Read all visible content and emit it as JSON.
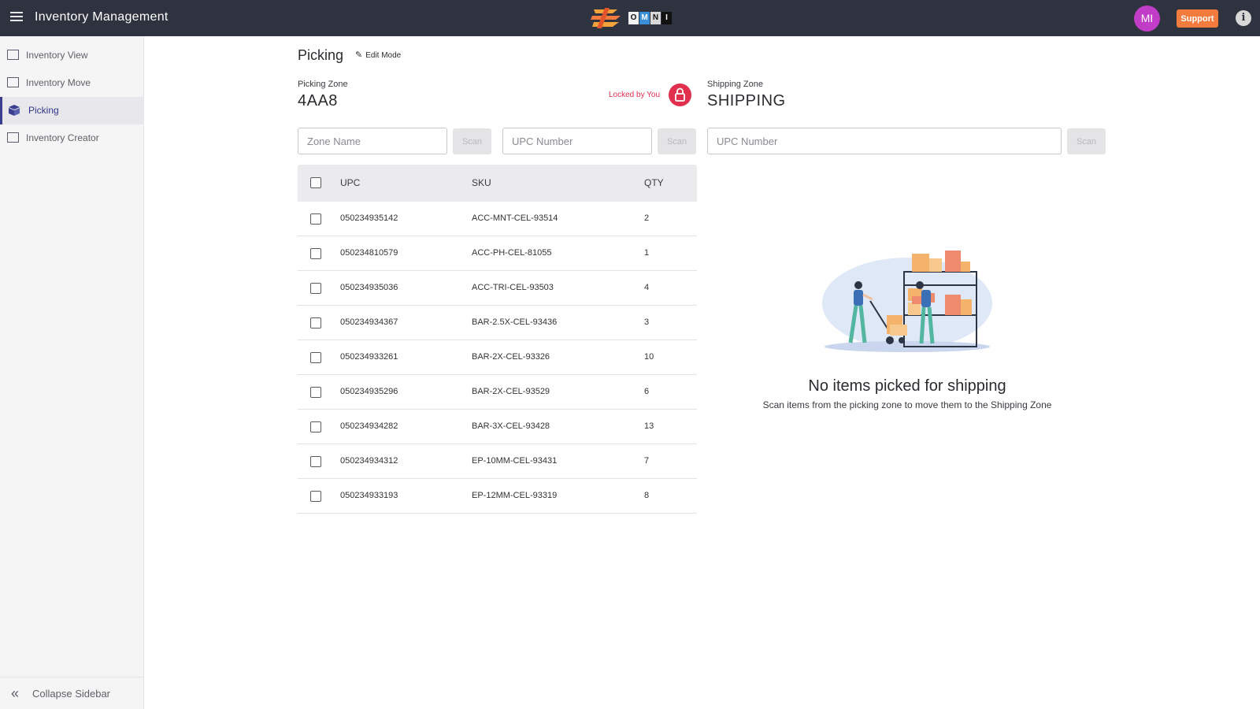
{
  "header": {
    "title": "Inventory Management",
    "brand_letters": [
      "O",
      "M",
      "N",
      "I"
    ],
    "brand_letter_colors": [
      "#f2f2f2",
      "#3a8fd9",
      "#d8d8d8",
      "#111111"
    ],
    "avatar_initials": "MI",
    "support_label": "Support",
    "info_glyph": "i"
  },
  "sidebar": {
    "items": [
      {
        "label": "Inventory View",
        "icon": "grid-icon",
        "active": false
      },
      {
        "label": "Inventory Move",
        "icon": "move-icon",
        "active": false
      },
      {
        "label": "Picking",
        "icon": "boxes-icon",
        "active": true
      },
      {
        "label": "Inventory Creator",
        "icon": "grid-icon",
        "active": false
      }
    ],
    "collapse_label": "Collapse Sidebar"
  },
  "main": {
    "title": "Picking",
    "edit_mode_label": "Edit Mode",
    "picking_zone_label": "Picking Zone",
    "picking_zone_value": "4AA8",
    "locked_label": "Locked by You",
    "shipping_zone_label": "Shipping Zone",
    "shipping_zone_value": "SHIPPING",
    "zone_name_placeholder": "Zone Name",
    "upc_placeholder": "UPC Number",
    "scan_label": "Scan"
  },
  "table": {
    "headers": {
      "upc": "UPC",
      "sku": "SKU",
      "qty": "QTY"
    },
    "rows": [
      {
        "upc": "050234935142",
        "sku": "ACC-MNT-CEL-93514",
        "qty": "2"
      },
      {
        "upc": "050234810579",
        "sku": "ACC-PH-CEL-81055",
        "qty": "1"
      },
      {
        "upc": "050234935036",
        "sku": "ACC-TRI-CEL-93503",
        "qty": "4"
      },
      {
        "upc": "050234934367",
        "sku": "BAR-2.5X-CEL-93436",
        "qty": "3"
      },
      {
        "upc": "050234933261",
        "sku": "BAR-2X-CEL-93326",
        "qty": "10"
      },
      {
        "upc": "050234935296",
        "sku": "BAR-2X-CEL-93529",
        "qty": "6"
      },
      {
        "upc": "050234934282",
        "sku": "BAR-3X-CEL-93428",
        "qty": "13"
      },
      {
        "upc": "050234934312",
        "sku": "EP-10MM-CEL-93431",
        "qty": "7"
      },
      {
        "upc": "050234933193",
        "sku": "EP-12MM-CEL-93319",
        "qty": "8"
      }
    ]
  },
  "empty_state": {
    "title": "No items picked for shipping",
    "subtitle": "Scan items from the picking zone to move them to the Shipping Zone",
    "illustration": "warehouse-workers-illustration"
  },
  "colors": {
    "topbar": "#2e333f",
    "accent": "#2f3687",
    "support": "#f47b3e",
    "avatar": "#c13dc7",
    "locked": "#e0304e"
  }
}
